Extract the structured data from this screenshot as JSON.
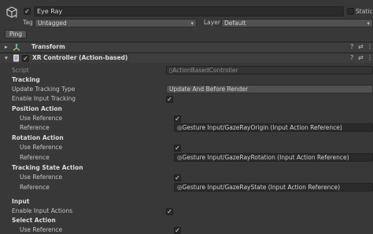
{
  "header": {
    "object_name": "Eye Ray",
    "static_label": "Static",
    "tag_label": "Tag",
    "tag_value": "Untagged",
    "layer_label": "Layer",
    "layer_value": "Default",
    "ping_button": "Ping"
  },
  "transform": {
    "title": "Transform"
  },
  "xr_controller": {
    "title": "XR Controller (Action-based)",
    "script_label": "Script",
    "script_value": "ActionBasedController",
    "tracking_header": "Tracking",
    "update_tracking_type_label": "Update Tracking Type",
    "update_tracking_type_value": "Update And Before Render",
    "enable_input_tracking_label": "Enable Input Tracking",
    "position_action": {
      "header": "Position Action",
      "use_reference_label": "Use Reference",
      "reference_label": "Reference",
      "reference_value": "Gesture Input/GazeRayOrigin (Input Action Reference)"
    },
    "rotation_action": {
      "header": "Rotation Action",
      "use_reference_label": "Use Reference",
      "reference_label": "Reference",
      "reference_value": "Gesture Input/GazeRayRotation (Input Action Reference)"
    },
    "tracking_state_action": {
      "header": "Tracking State Action",
      "use_reference_label": "Use Reference",
      "reference_label": "Reference",
      "reference_value": "Gesture Input/GazeRayState (Input Action Reference)"
    },
    "input_header": "Input",
    "enable_input_actions_label": "Enable Input Actions",
    "select_action": {
      "header": "Select Action",
      "use_reference_label": "Use Reference"
    }
  },
  "icons": {
    "cube": "cube-icon",
    "check": "✓",
    "chevron_down": "▾",
    "fold_right": "▸",
    "fold_down": "▾",
    "help": "?",
    "presets": "⇄",
    "menu": "⋮",
    "object_picker": "◎"
  }
}
